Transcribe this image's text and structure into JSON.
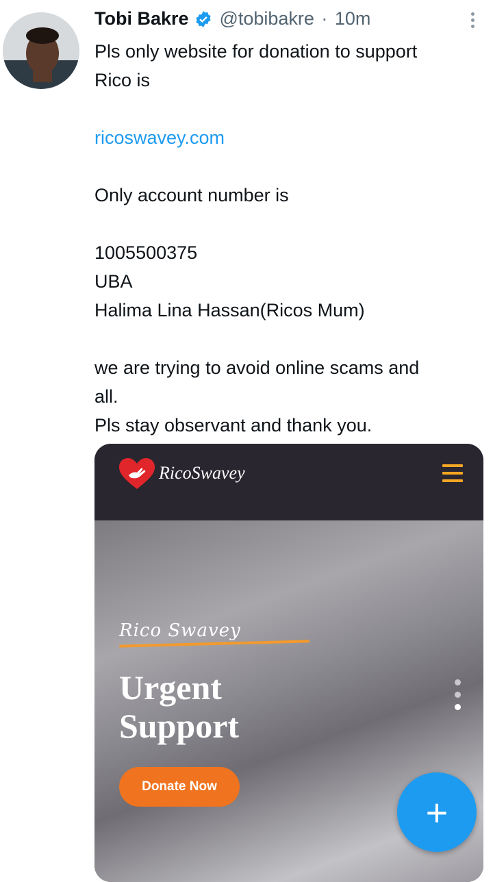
{
  "tweet": {
    "author_name": "Tobi Bakre",
    "handle": "@tobibakre",
    "time_separator": "·",
    "time": "10m",
    "lines": [
      "Pls only website for donation to support",
      "Rico is"
    ],
    "link": "ricoswavey.com",
    "account_intro": "Only account number is",
    "account_number": "1005500375",
    "bank": "UBA",
    "account_name": "Halima Lina Hassan(Ricos Mum)",
    "closing_1": "we are trying to avoid online scams and",
    "closing_2": "all.",
    "closing_3": "Pls stay observant and thank you."
  },
  "card": {
    "logo_text": "RicoSwavey",
    "signature": "Rico Swavey",
    "headline_1": "Urgent",
    "headline_2": "Support",
    "donate_label": "Donate Now"
  },
  "fab": {
    "label": "+"
  },
  "colors": {
    "link": "#1d9bf0",
    "verified": "#1d9bf0",
    "accent_orange": "#f0731f",
    "menu_orange": "#f5a623",
    "site_header": "#2a2630"
  },
  "icons": [
    "verified-badge-icon",
    "more-options-icon",
    "heart-logo-icon",
    "hamburger-menu-icon",
    "compose-plus-icon"
  ]
}
